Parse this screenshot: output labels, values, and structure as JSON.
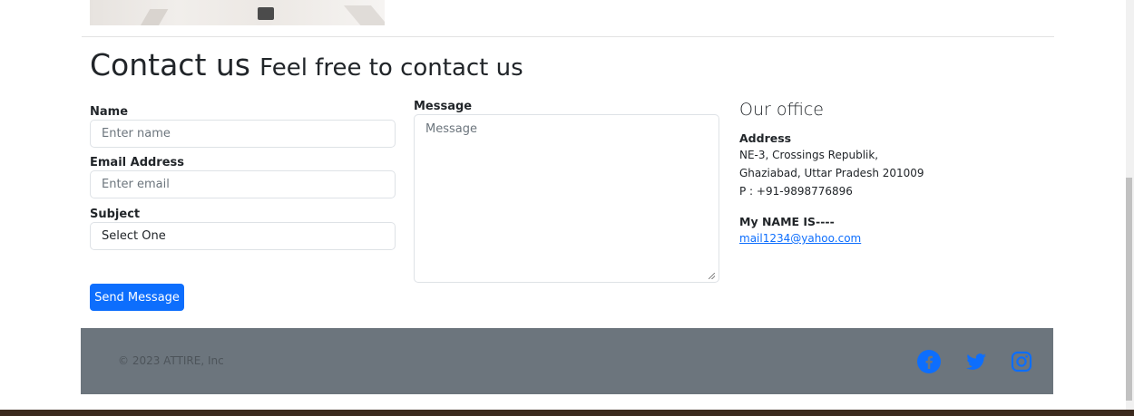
{
  "heading": {
    "main": "Contact us",
    "sub": "Feel free to contact us"
  },
  "form": {
    "name_label": "Name",
    "name_placeholder": "Enter name",
    "email_label": "Email Address",
    "email_placeholder": "Enter email",
    "subject_label": "Subject",
    "subject_selected": "Select One",
    "message_label": "Message",
    "message_placeholder": "Message",
    "submit_label": "Send Message"
  },
  "office": {
    "title": "Our office",
    "address_label": "Address",
    "address_line1": "NE-3, Crossings Republik,",
    "address_line2": "Ghaziabad, Uttar Pradesh 201009",
    "phone": "P : +91-9898776896",
    "name_line": "My NAME IS----",
    "email": "mail1234@yahoo.com"
  },
  "footer": {
    "copyright": "© 2023 ATTIRE, Inc",
    "social": [
      {
        "icon": "facebook-icon",
        "color": "#0d6efd"
      },
      {
        "icon": "twitter-icon",
        "color": "#0d6efd"
      },
      {
        "icon": "instagram-icon",
        "color": "#0d6efd"
      }
    ]
  },
  "colors": {
    "primary": "#0d6efd",
    "footer_bg": "#6c757d"
  }
}
